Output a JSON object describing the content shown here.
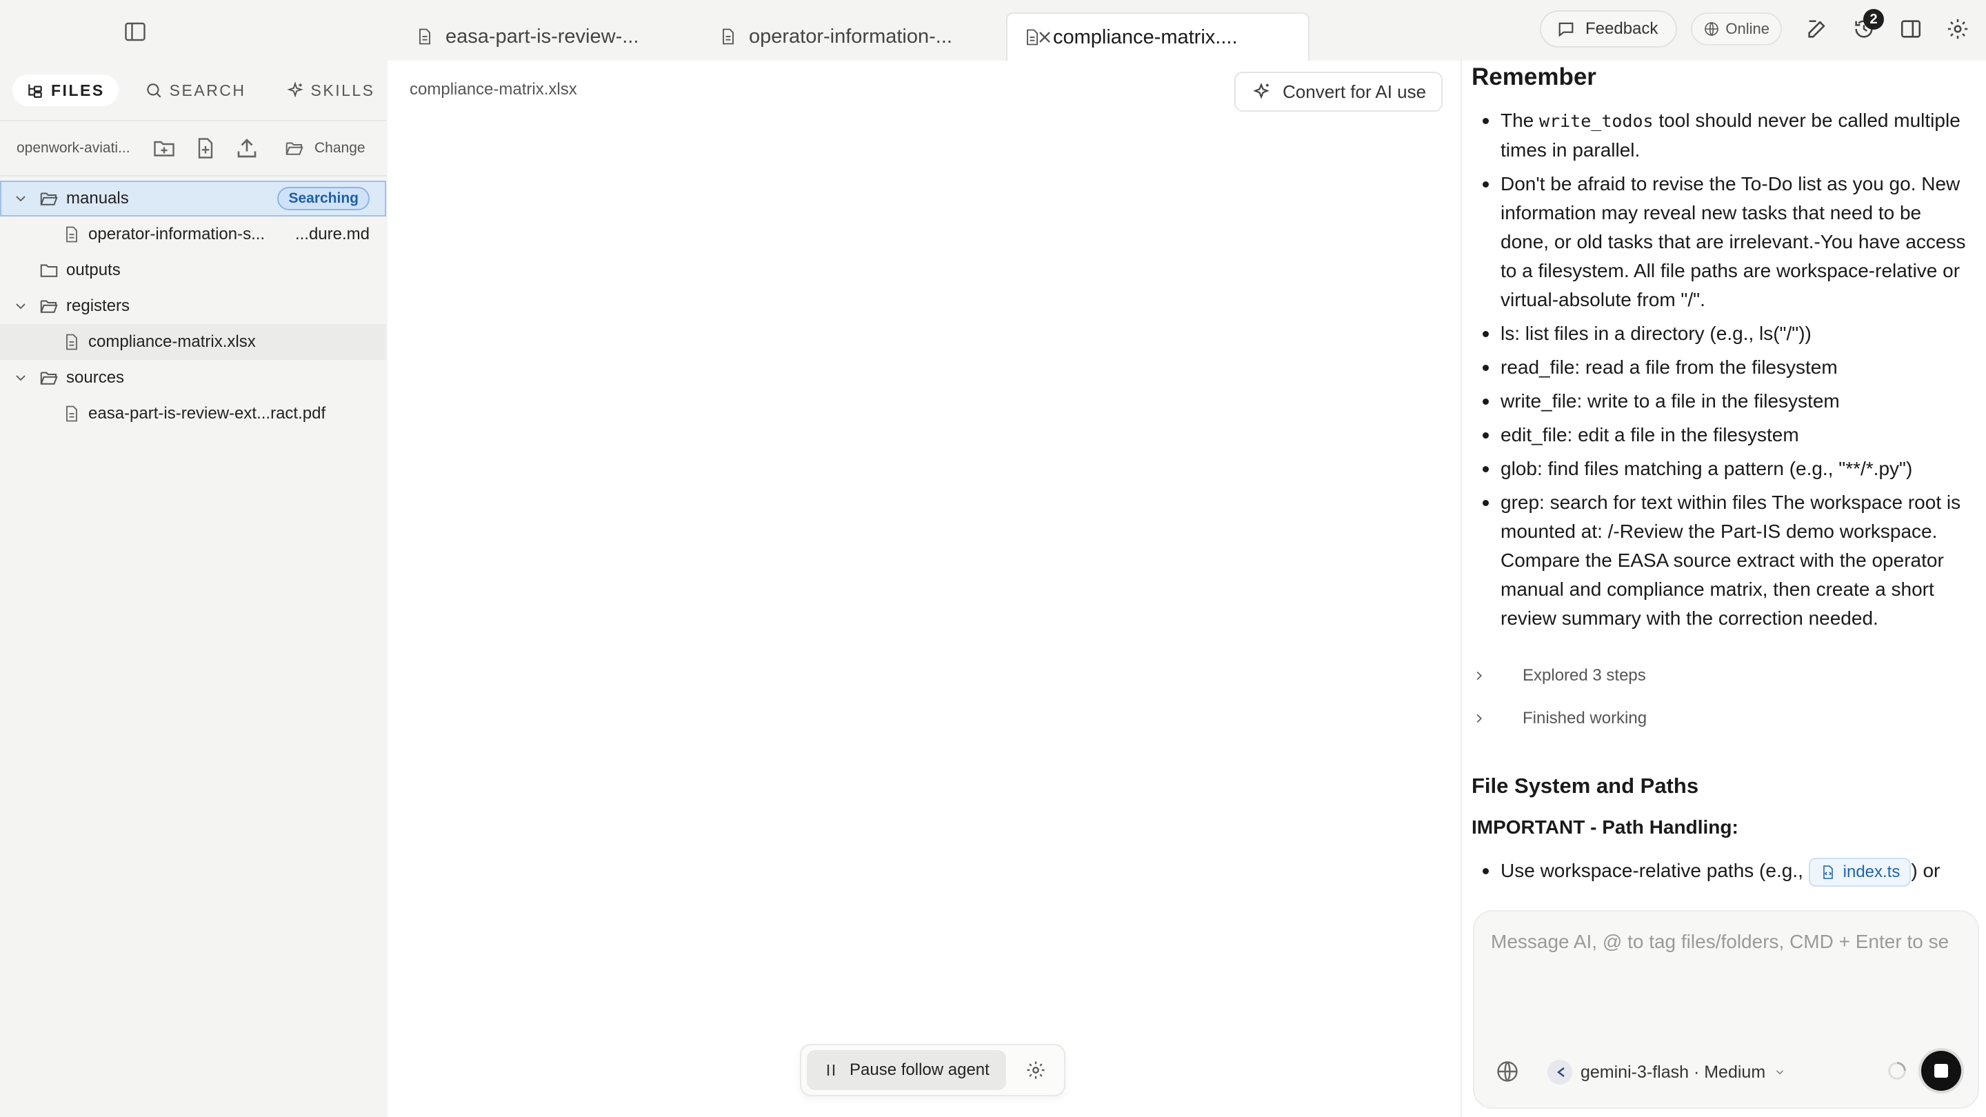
{
  "sidebar": {
    "tabs": [
      {
        "label": "FILES",
        "icon": "file-tree-icon",
        "active": true
      },
      {
        "label": "SEARCH",
        "icon": "search-icon",
        "active": false
      },
      {
        "label": "SKILLS",
        "icon": "sparkle-icon",
        "active": false
      }
    ],
    "workspace": {
      "name": "openwork-aviati...",
      "change_label": "Change"
    },
    "tree": [
      {
        "type": "folder",
        "label": "manuals",
        "expanded": true,
        "badge": "Searching"
      },
      {
        "type": "file",
        "label": "operator-information-s...",
        "label_right": "...dure.md"
      },
      {
        "type": "folder",
        "label": "outputs",
        "expanded": false
      },
      {
        "type": "folder",
        "label": "registers",
        "expanded": true
      },
      {
        "type": "file",
        "label": "compliance-matrix.xlsx"
      },
      {
        "type": "folder",
        "label": "sources",
        "expanded": true
      },
      {
        "type": "file",
        "label": "easa-part-is-review-ext...ract.pdf"
      }
    ]
  },
  "editor": {
    "tabs": [
      {
        "label": "easa-part-is-review-...",
        "active": false
      },
      {
        "label": "operator-information-...",
        "active": false
      },
      {
        "label": "compliance-matrix....",
        "active": true
      }
    ],
    "filename": "compliance-matrix.xlsx",
    "convert_label": "Convert for AI use",
    "pause_label": "Pause follow agent"
  },
  "toolbar": {
    "feedback_label": "Feedback",
    "online_label": "Online",
    "history_badge": "2"
  },
  "chat": {
    "remember_heading": "Remember",
    "remember_items": [
      {
        "pre": "The ",
        "code": "write_todos",
        "post": " tool should never be called multiple times in parallel."
      },
      {
        "text": "Don't be afraid to revise the To-Do list as you go. New information may reveal new tasks that need to be done, or old tasks that are irrelevant.-You have access to a filesystem. All file paths are workspace-relative or virtual-absolute from \"/\"."
      },
      {
        "text": "ls: list files in a directory (e.g., ls(\"/\"))"
      },
      {
        "text": "read_file: read a file from the filesystem"
      },
      {
        "text": "write_file: write to a file in the filesystem"
      },
      {
        "text": "edit_file: edit a file in the filesystem"
      },
      {
        "text": "glob: find files matching a pattern (e.g., \"**/*.py\")"
      },
      {
        "text": "grep: search for text within files The workspace root is mounted at: /-Review the Part-IS demo workspace. Compare the EASA source extract with the operator manual and compliance matrix, then create a short review summary with the correction needed."
      }
    ],
    "steps": [
      {
        "label": "Explored 3 steps"
      },
      {
        "label": "Finished working"
      }
    ],
    "fs_heading": "File System and Paths",
    "important_label": "IMPORTANT - Path Handling:",
    "path_item_pre": "Use workspace-relative paths (e.g.,",
    "path_chip": "index.ts",
    "path_item_post": ") or",
    "composer": {
      "placeholder": "Message AI, @ to tag files/folders, CMD + Enter to se",
      "model": "gemini-3-flash · Medium"
    }
  },
  "colors": {
    "accent_blue": "#1f63b3",
    "selection_bg": "#dce9f7",
    "badge_bg": "#cfe2f7"
  }
}
